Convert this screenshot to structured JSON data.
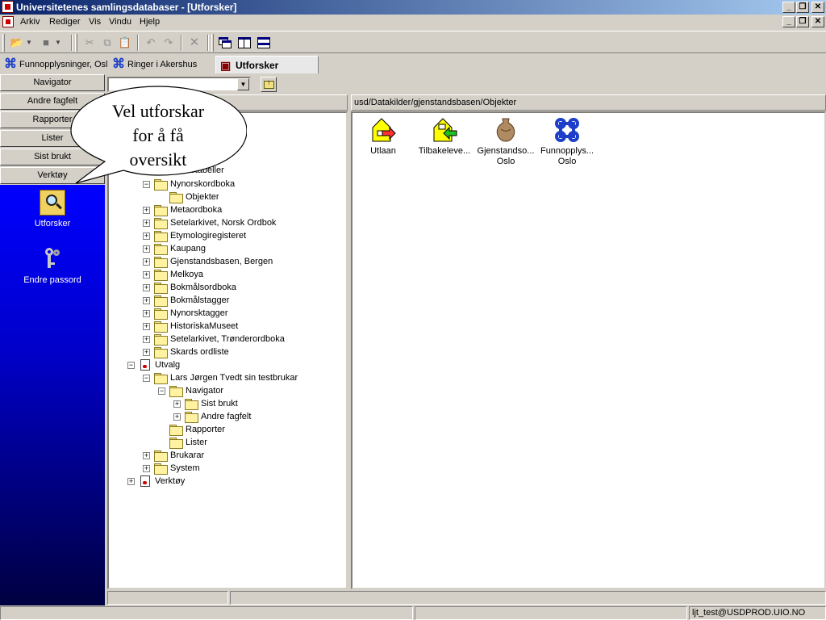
{
  "window": {
    "title": "Universitetenes samlingsdatabaser - [Utforsker]"
  },
  "menu": {
    "items": [
      "Arkiv",
      "Rediger",
      "Vis",
      "Vindu",
      "Hjelp"
    ]
  },
  "tabs": [
    {
      "label": "Funnopplysninger, Osl"
    },
    {
      "label": "Ringer i Akershus"
    },
    {
      "label": "Utforsker"
    }
  ],
  "navigator": {
    "buttons": [
      "Navigator",
      "Andre fagfelt",
      "Rapporter",
      "Lister",
      "Sist brukt",
      "Verktøy"
    ],
    "tools": [
      {
        "label": "Utforsker",
        "icon": "explorer-magnifier-icon"
      },
      {
        "label": "Endre passord",
        "icon": "keys-icon"
      }
    ]
  },
  "balloon": {
    "text": [
      "Vel utforskar",
      "for å få",
      "oversikt"
    ]
  },
  "list": {
    "path": "usd/Datakilder/gjenstandsbasen/Objekter",
    "items": [
      {
        "line1": "Utlaan",
        "line2": ""
      },
      {
        "line1": "Tilbakeleve...",
        "line2": ""
      },
      {
        "line1": "Gjenstandso...",
        "line2": "Oslo"
      },
      {
        "line1": "Funnopplys...",
        "line2": "Oslo"
      }
    ]
  },
  "tree": {
    "rows": [
      {
        "label": "...ransetabeller"
      },
      {
        "label": "Nynorskordboka"
      },
      {
        "label": "Objekter"
      },
      {
        "label": "Metaordboka"
      },
      {
        "label": "Setelarkivet, Norsk Ordbok"
      },
      {
        "label": "Etymologiregisteret"
      },
      {
        "label": "Kaupang"
      },
      {
        "label": "Gjenstandsbasen, Bergen"
      },
      {
        "label": "Melkoya"
      },
      {
        "label": "Bokmålsordboka"
      },
      {
        "label": "Bokmålstagger"
      },
      {
        "label": "Nynorsktagger"
      },
      {
        "label": "HistoriskaMuseet"
      },
      {
        "label": "Setelarkivet, Trønderordboka"
      },
      {
        "label": "Skards ordliste"
      },
      {
        "label": "Utvalg"
      },
      {
        "label": "Lars Jørgen Tvedt sin testbrukar"
      },
      {
        "label": "Navigator"
      },
      {
        "label": "Sist brukt"
      },
      {
        "label": "Andre fagfelt"
      },
      {
        "label": "Rapporter"
      },
      {
        "label": "Lister"
      },
      {
        "label": "Brukarar"
      },
      {
        "label": "System"
      },
      {
        "label": "Verktøy"
      }
    ]
  },
  "status": {
    "user": "ljt_test@USDPROD.UIO.NO"
  },
  "colors": {
    "titlebar": "#0a246a",
    "navpanel": "#0000ff",
    "balloon_fill": "#ffffff"
  }
}
